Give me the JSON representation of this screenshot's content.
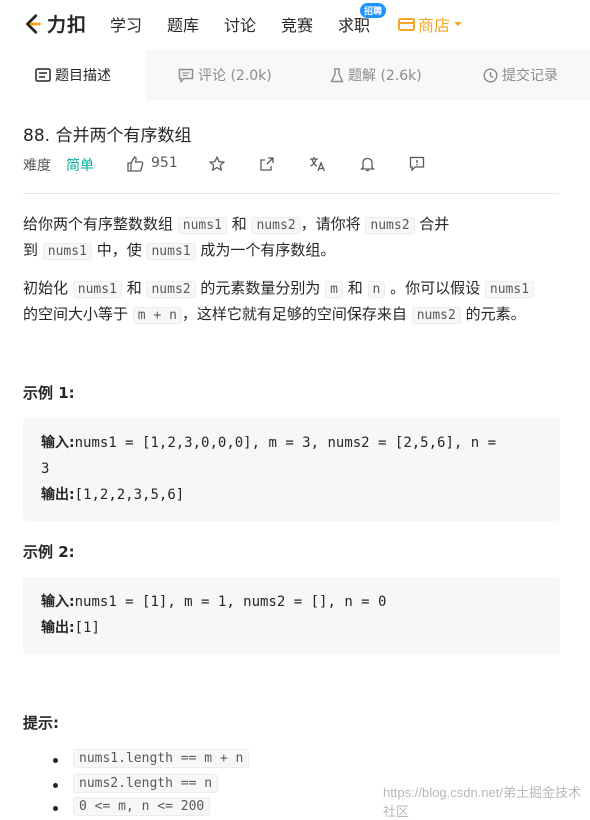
{
  "nav": {
    "logo_text": "力扣",
    "items": [
      "学习",
      "题库",
      "讨论",
      "竞赛",
      "求职"
    ],
    "badge": "招聘",
    "shop": "商店"
  },
  "tabs": [
    {
      "label": "题目描述",
      "icon": "description-icon"
    },
    {
      "label": "评论 (2.0k)",
      "icon": "comment-icon"
    },
    {
      "label": "题解 (2.6k)",
      "icon": "flask-icon"
    },
    {
      "label": "提交记录",
      "icon": "clock-icon"
    }
  ],
  "problem": {
    "title": "88. 合并两个有序数组",
    "difficulty_label": "难度",
    "difficulty": "简单",
    "likes": "951"
  },
  "description": {
    "p1": [
      "给你两个有序整数数组 ",
      "nums1",
      " 和 ",
      "nums2",
      "，请你将 ",
      "nums2",
      " 合并",
      "到 ",
      "nums1",
      " 中，使 ",
      "nums1",
      " 成为一个有序数组。"
    ],
    "p2": [
      "初始化 ",
      "nums1",
      " 和 ",
      "nums2",
      " 的元素数量分别为 ",
      "m",
      " 和 ",
      "n",
      " 。你可以假设 ",
      "nums1",
      "的空间大小等于 ",
      "m + n",
      "，这样它就有足够的空间保存来自 ",
      "nums2",
      " 的元素。"
    ]
  },
  "examples": [
    {
      "heading": "示例 1:",
      "input_label": "输入:",
      "input": "nums1 = [1,2,3,0,0,0], m = 3, nums2 = [2,5,6], n =",
      "input_cont": "3",
      "output_label": "输出:",
      "output": "[1,2,2,3,5,6]"
    },
    {
      "heading": "示例 2:",
      "input_label": "输入:",
      "input": "nums1 = [1], m = 1, nums2 = [], n = 0",
      "output_label": "输出:",
      "output": "[1]"
    }
  ],
  "hints": {
    "heading": "提示:",
    "items": [
      "nums1.length == m + n",
      "nums2.length == n",
      "0 <= m, n <= 200"
    ]
  },
  "watermark": "https://blog.csdn.net/弟土掘金技术社区",
  "colors": {
    "easy": "#00af9b",
    "shop": "#f5a623",
    "badge": "#1e90ff",
    "logo_orange": "#ffa116"
  }
}
